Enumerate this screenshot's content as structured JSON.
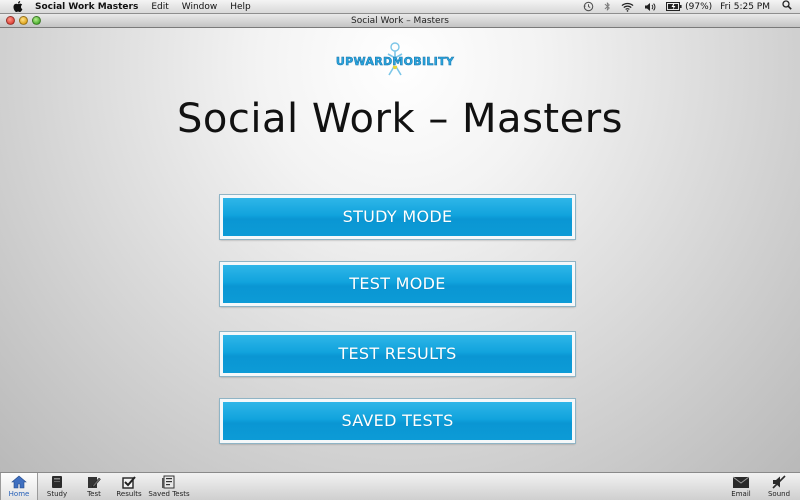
{
  "menubar": {
    "app_name": "Social Work Masters",
    "items": [
      "Edit",
      "Window",
      "Help"
    ],
    "battery": "(97%)",
    "clock": "Fri 5:25 PM"
  },
  "window": {
    "title": "Social Work – Masters"
  },
  "logo": {
    "text": "UPWARDMOBILITY"
  },
  "main": {
    "title": "Social Work – Masters",
    "buttons": {
      "study": "STUDY MODE",
      "test": "TEST MODE",
      "results": "TEST RESULTS",
      "saved": "SAVED TESTS"
    }
  },
  "toolbar": {
    "home": "Home",
    "study": "Study",
    "test": "Test",
    "results": "Results",
    "saved_tests": "Saved Tests",
    "email": "Email",
    "sound": "Sound"
  },
  "colors": {
    "button_blue": "#11a3dd",
    "logo_blue": "#27a7e1",
    "active_tab": "#2660b8"
  }
}
